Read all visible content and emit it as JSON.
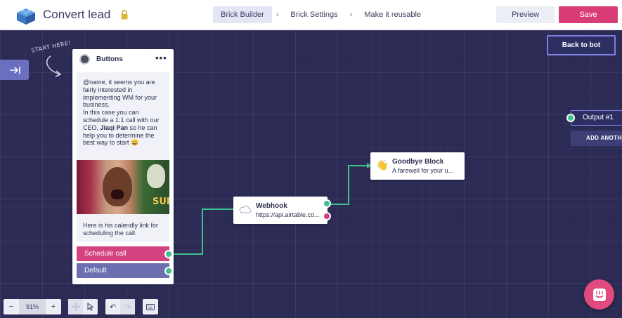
{
  "header": {
    "title": "Convert lead",
    "logo_icon": "lego-brick-icon",
    "lock_icon": "lock-icon",
    "steps": [
      {
        "label": "Brick Builder",
        "active": true
      },
      {
        "label": "Brick Settings",
        "active": false
      },
      {
        "label": "Make it reusable",
        "active": false
      }
    ],
    "step_separator": "›",
    "preview_label": "Preview",
    "save_label": "Save"
  },
  "canvas": {
    "start_hint": "START HERE!",
    "back_to_bot_label": "Back to bot",
    "buttons_block": {
      "title": "Buttons",
      "more_label": "•••",
      "message_before": "@name, it seems you are fairly interested in implementing WM for your business.\nIn this case you can schedule a 1:1 call with our CEO, ",
      "message_bold": "Jiaqi Pan",
      "message_after": " so he can help you to determine the best way to start 😀",
      "gif_text": "SUI",
      "caption": "Here is his calendly link for scheduling the call.",
      "buttons": [
        "Schedule call",
        "Default"
      ]
    },
    "webhook_block": {
      "title": "Webhook",
      "subtitle": "https://api.airtable.co...",
      "icon": "cloud-icon"
    },
    "goodbye_block": {
      "title": "Goodbye Block",
      "subtitle": "A farewell for your u...",
      "icon": "👋"
    },
    "output_block": {
      "label": "Output #1",
      "add_label": "ADD ANOTHER"
    }
  },
  "toolbar": {
    "zoom_minus": "−",
    "zoom_value": "91%",
    "zoom_plus": "+",
    "move_icon": "move-icon",
    "pointer_icon": "pointer-icon",
    "undo_label": "↶",
    "redo_label": "↷",
    "keyboard_icon": "keyboard-icon"
  },
  "colors": {
    "canvas": "#2b2b55",
    "accent_pink": "#d93d77",
    "accent_green": "#3ec18f",
    "accent_purple": "#6c6fb0"
  }
}
